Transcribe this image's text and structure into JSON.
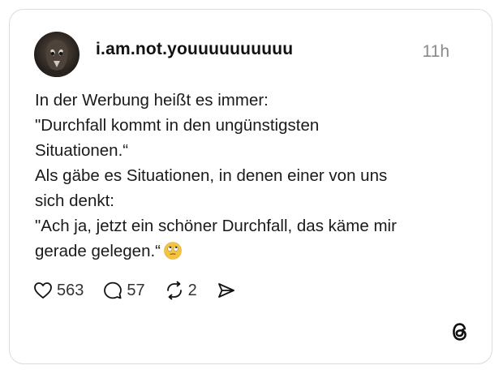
{
  "post": {
    "username": "i.am.not.youuuuuuuuuu",
    "timestamp": "11h",
    "text_lines": [
      "In der Werbung heißt es immer:",
      "\"Durchfall kommt in den ungünstigsten",
      "Situationen.“",
      "Als gäbe es Situationen, in denen einer von uns",
      "sich denkt:",
      "\"Ach ja, jetzt ein schöner Durchfall, das käme mir",
      "gerade gelegen.“"
    ],
    "emoji": "face-with-rolling-eyes"
  },
  "actions": {
    "likes": "563",
    "comments": "57",
    "reposts": "2",
    "like_icon": "heart-icon",
    "comment_icon": "comment-bubble-icon",
    "repost_icon": "repost-icon",
    "share_icon": "send-icon"
  },
  "branding": {
    "logo": "threads-logo-icon"
  },
  "colors": {
    "text": "#111111",
    "muted": "#8a8a8a",
    "border": "#dcdcdc",
    "emoji_face": "#f5c342"
  }
}
